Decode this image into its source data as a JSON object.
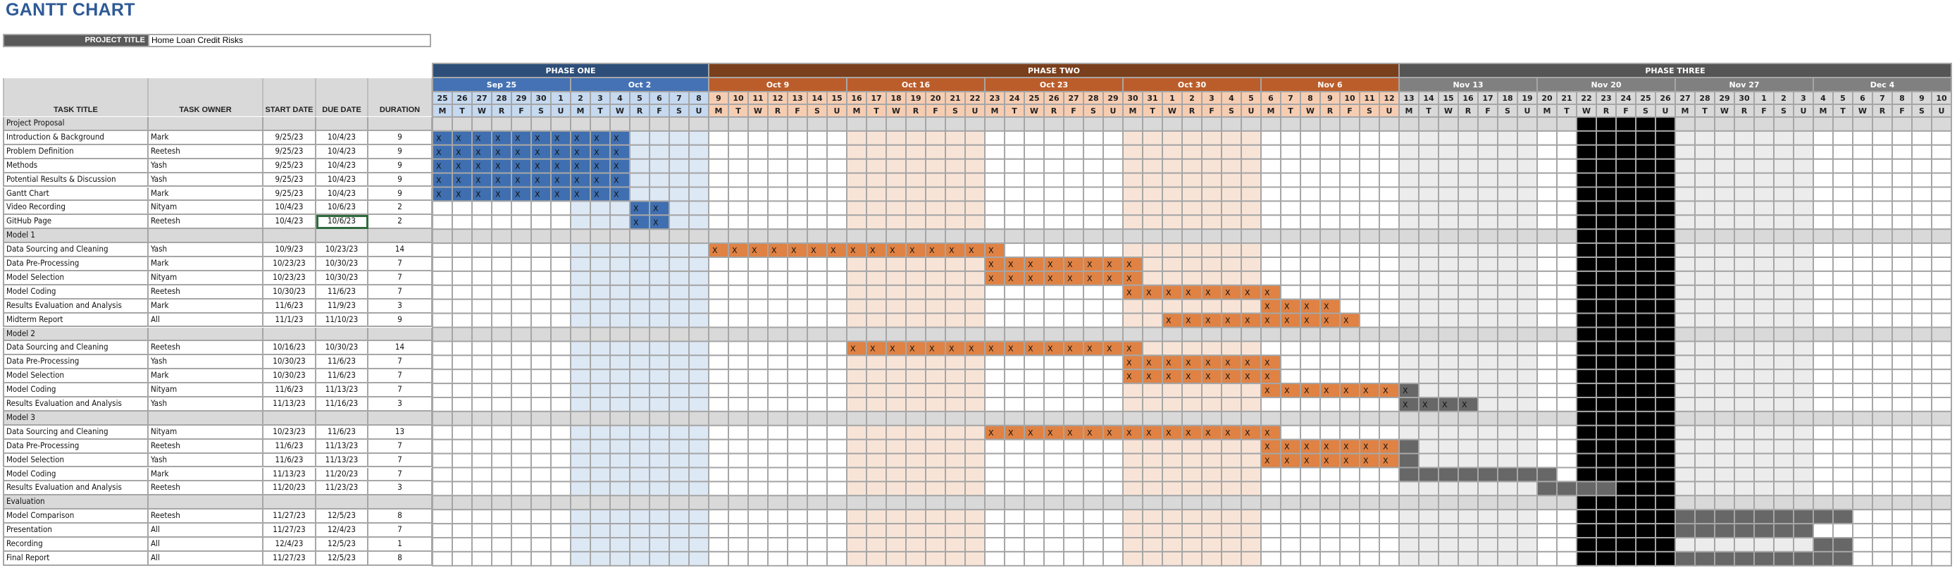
{
  "title": "GANTT CHART",
  "project": {
    "label": "PROJECT TITLE",
    "value": "Home Loan Credit Risks"
  },
  "columns": {
    "task_title": "TASK TITLE",
    "task_owner": "TASK OWNER",
    "start_date": "START DATE",
    "due_date": "DUE DATE",
    "duration": "DURATION"
  },
  "selected_cell": {
    "row": 7,
    "column": "due_date"
  },
  "chart_data": {
    "type": "table",
    "title": "GANTT CHART",
    "timeline_start": "2023-09-25",
    "timeline_end": "2023-12-10",
    "phases": [
      {
        "name": "PHASE ONE",
        "weeks": [
          "Sep 25",
          "Oct 2"
        ],
        "colors": {
          "header": "#2d4e79",
          "week": "#4472b4",
          "day": "#c5d9f0",
          "bar": "#3f6fb0",
          "shade": "#dde8f5"
        }
      },
      {
        "name": "PHASE TWO",
        "weeks": [
          "Oct 9",
          "Oct 16",
          "Oct 23",
          "Oct 30",
          "Nov 6"
        ],
        "colors": {
          "header": "#7a3f1c",
          "week": "#bb5d2b",
          "day": "#f7cdb2",
          "bar": "#df8244",
          "shade": "#f8e4d7"
        }
      },
      {
        "name": "PHASE THREE",
        "weeks": [
          "Nov 13",
          "Nov 20",
          "Nov 27",
          "Dec 4"
        ],
        "colors": {
          "header": "#555555",
          "week": "#808080",
          "day": "#d9d9d9",
          "bar": "#676767",
          "shade": "#ececec"
        }
      }
    ],
    "shaded_weeks": [
      "Oct 2",
      "Oct 16",
      "Oct 30",
      "Nov 13",
      "Nov 27"
    ],
    "blocked_days": [
      "2023-11-22",
      "2023-11-23",
      "2023-11-24",
      "2023-11-25",
      "2023-11-26"
    ],
    "blocked_color": "#000000",
    "day_letters": [
      "M",
      "T",
      "W",
      "R",
      "F",
      "S",
      "U"
    ],
    "mark": "X",
    "rows": [
      {
        "type": "section",
        "title": "Project Proposal"
      },
      {
        "type": "task",
        "title": "Introduction & Background",
        "owner": "Mark",
        "start": "9/25/23",
        "due": "10/4/23",
        "duration": "9",
        "bar": {
          "from": "2023-09-25",
          "to": "2023-10-04",
          "x_to": "2023-10-04"
        }
      },
      {
        "type": "task",
        "title": "Problem Definition",
        "owner": "Reetesh",
        "start": "9/25/23",
        "due": "10/4/23",
        "duration": "9",
        "bar": {
          "from": "2023-09-25",
          "to": "2023-10-04",
          "x_to": "2023-10-04"
        }
      },
      {
        "type": "task",
        "title": "Methods",
        "owner": "Yash",
        "start": "9/25/23",
        "due": "10/4/23",
        "duration": "9",
        "bar": {
          "from": "2023-09-25",
          "to": "2023-10-04",
          "x_to": "2023-10-04"
        }
      },
      {
        "type": "task",
        "title": "Potential Results & Discussion",
        "owner": "Yash",
        "start": "9/25/23",
        "due": "10/4/23",
        "duration": "9",
        "bar": {
          "from": "2023-09-25",
          "to": "2023-10-04",
          "x_to": "2023-10-04"
        }
      },
      {
        "type": "task",
        "title": "Gantt Chart",
        "owner": "Mark",
        "start": "9/25/23",
        "due": "10/4/23",
        "duration": "9",
        "bar": {
          "from": "2023-09-25",
          "to": "2023-10-04",
          "x_to": "2023-10-04"
        }
      },
      {
        "type": "task",
        "title": "Video Recording",
        "owner": "Nityam",
        "start": "10/4/23",
        "due": "10/6/23",
        "duration": "2",
        "bar": {
          "from": "2023-10-05",
          "to": "2023-10-06",
          "x_to": "2023-10-06"
        }
      },
      {
        "type": "task",
        "title": "GitHub Page",
        "owner": "Reetesh",
        "start": "10/4/23",
        "due": "10/6/23",
        "duration": "2",
        "bar": {
          "from": "2023-10-05",
          "to": "2023-10-06",
          "x_to": "2023-10-06"
        }
      },
      {
        "type": "section",
        "title": "Model 1"
      },
      {
        "type": "task",
        "title": "Data Sourcing and Cleaning",
        "owner": "Yash",
        "start": "10/9/23",
        "due": "10/23/23",
        "duration": "14",
        "bar": {
          "from": "2023-10-09",
          "to": "2023-10-23",
          "x_to": "2023-10-23"
        }
      },
      {
        "type": "task",
        "title": "Data Pre-Processing",
        "owner": "Mark",
        "start": "10/23/23",
        "due": "10/30/23",
        "duration": "7",
        "bar": {
          "from": "2023-10-23",
          "to": "2023-10-30",
          "x_to": "2023-10-30"
        }
      },
      {
        "type": "task",
        "title": "Model Selection",
        "owner": "Nityam",
        "start": "10/23/23",
        "due": "10/30/23",
        "duration": "7",
        "bar": {
          "from": "2023-10-23",
          "to": "2023-10-30",
          "x_to": "2023-10-30"
        }
      },
      {
        "type": "task",
        "title": "Model Coding",
        "owner": "Reetesh",
        "start": "10/30/23",
        "due": "11/6/23",
        "duration": "7",
        "bar": {
          "from": "2023-10-30",
          "to": "2023-11-06",
          "x_to": "2023-11-06"
        }
      },
      {
        "type": "task",
        "title": "Results Evaluation and Analysis",
        "owner": "Mark",
        "start": "11/6/23",
        "due": "11/9/23",
        "duration": "3",
        "bar": {
          "from": "2023-11-06",
          "to": "2023-11-09",
          "x_to": "2023-11-09"
        }
      },
      {
        "type": "task",
        "title": "Midterm Report",
        "owner": "All",
        "start": "11/1/23",
        "due": "11/10/23",
        "duration": "9",
        "bar": {
          "from": "2023-11-01",
          "to": "2023-11-10",
          "x_to": "2023-11-10"
        }
      },
      {
        "type": "section",
        "title": "Model 2"
      },
      {
        "type": "task",
        "title": "Data Sourcing and Cleaning",
        "owner": "Reetesh",
        "start": "10/16/23",
        "due": "10/30/23",
        "duration": "14",
        "bar": {
          "from": "2023-10-16",
          "to": "2023-10-30",
          "x_to": "2023-10-30"
        }
      },
      {
        "type": "task",
        "title": "Data Pre-Processing",
        "owner": "Yash",
        "start": "10/30/23",
        "due": "11/6/23",
        "duration": "7",
        "bar": {
          "from": "2023-10-30",
          "to": "2023-11-06",
          "x_to": "2023-11-06"
        }
      },
      {
        "type": "task",
        "title": "Model Selection",
        "owner": "Mark",
        "start": "10/30/23",
        "due": "11/6/23",
        "duration": "7",
        "bar": {
          "from": "2023-10-30",
          "to": "2023-11-06",
          "x_to": "2023-11-06"
        }
      },
      {
        "type": "task",
        "title": "Model Coding",
        "owner": "Nityam",
        "start": "11/6/23",
        "due": "11/13/23",
        "duration": "7",
        "bar": {
          "from": "2023-11-06",
          "to": "2023-11-13",
          "x_to": "2023-11-13"
        }
      },
      {
        "type": "task",
        "title": "Results Evaluation and Analysis",
        "owner": "Yash",
        "start": "11/13/23",
        "due": "11/16/23",
        "duration": "3",
        "bar": {
          "from": "2023-11-13",
          "to": "2023-11-16",
          "x_to": "2023-11-16"
        }
      },
      {
        "type": "section",
        "title": "Model 3"
      },
      {
        "type": "task",
        "title": "Data Sourcing and Cleaning",
        "owner": "Nityam",
        "start": "10/23/23",
        "due": "11/6/23",
        "duration": "13",
        "bar": {
          "from": "2023-10-23",
          "to": "2023-11-06",
          "x_to": "2023-11-06"
        }
      },
      {
        "type": "task",
        "title": "Data Pre-Processing",
        "owner": "Reetesh",
        "start": "11/6/23",
        "due": "11/13/23",
        "duration": "7",
        "bar": {
          "from": "2023-11-06",
          "to": "2023-11-13",
          "x_to": "2023-11-12"
        }
      },
      {
        "type": "task",
        "title": "Model Selection",
        "owner": "Yash",
        "start": "11/6/23",
        "due": "11/13/23",
        "duration": "7",
        "bar": {
          "from": "2023-11-06",
          "to": "2023-11-13",
          "x_to": "2023-11-12"
        }
      },
      {
        "type": "task",
        "title": "Model Coding",
        "owner": "Mark",
        "start": "11/13/23",
        "due": "11/20/23",
        "duration": "7",
        "bar": {
          "from": "2023-11-13",
          "to": "2023-11-20",
          "x_to": null
        }
      },
      {
        "type": "task",
        "title": "Results Evaluation and Analysis",
        "owner": "Reetesh",
        "start": "11/20/23",
        "due": "11/23/23",
        "duration": "3",
        "bar": {
          "from": "2023-11-20",
          "to": "2023-11-23",
          "x_to": null
        }
      },
      {
        "type": "section",
        "title": "Evaluation"
      },
      {
        "type": "task",
        "title": "Model Comparison",
        "owner": "Reetesh",
        "start": "11/27/23",
        "due": "12/5/23",
        "duration": "8",
        "bar": {
          "from": "2023-11-27",
          "to": "2023-12-05",
          "x_to": null
        }
      },
      {
        "type": "task",
        "title": "Presentation",
        "owner": "All",
        "start": "11/27/23",
        "due": "12/4/23",
        "duration": "7",
        "bar": {
          "from": "2023-11-27",
          "to": "2023-12-03",
          "x_to": null
        }
      },
      {
        "type": "task",
        "title": "Recording",
        "owner": "All",
        "start": "12/4/23",
        "due": "12/5/23",
        "duration": "1",
        "bar": {
          "from": "2023-12-04",
          "to": "2023-12-05",
          "x_to": null
        }
      },
      {
        "type": "task",
        "title": "Final Report",
        "owner": "All",
        "start": "11/27/23",
        "due": "12/5/23",
        "duration": "8",
        "bar": {
          "from": "2023-11-27",
          "to": "2023-12-05",
          "x_to": null
        }
      }
    ]
  }
}
